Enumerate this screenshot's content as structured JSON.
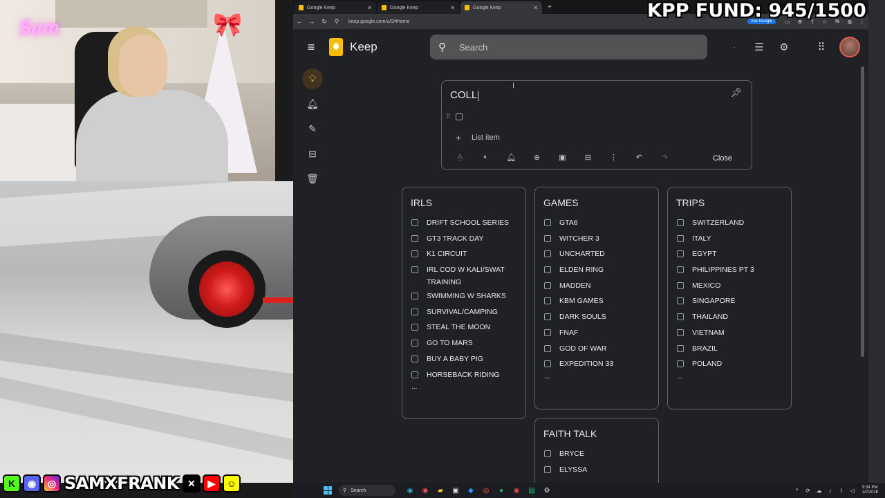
{
  "overlay": {
    "fund_text": "KPP FUND: 945/1500",
    "neon_sign": "Sam",
    "social_handle": "SAMXFRANK",
    "social_icons": [
      "kick-icon",
      "discord-icon",
      "instagram-icon",
      "x-icon",
      "youtube-icon",
      "snapchat-icon"
    ]
  },
  "browser": {
    "tabs": [
      {
        "label": "Google Keep",
        "active": false
      },
      {
        "label": "Google Keep",
        "active": false
      },
      {
        "label": "Google Keep",
        "active": true
      }
    ],
    "url": "keep.google.com/u/0/#home",
    "ask_google": "Ask Google"
  },
  "keep": {
    "app_title": "Keep",
    "search": {
      "placeholder": "Search",
      "value": ""
    },
    "sidebar": [
      "notes-bulb-icon",
      "reminders-bell-icon",
      "edit-labels-pencil-icon",
      "archive-icon",
      "trash-icon"
    ],
    "editor": {
      "title": "COLL",
      "add_item_label": "List item",
      "close_label": "Close"
    },
    "cards": [
      {
        "title": "IRLS",
        "items": [
          "DRIFT SCHOOL SERIES",
          "GT3 TRACK DAY",
          "K1 CIRCUIT",
          "IRL COD W KALI/SWAT TRAINING",
          "SWIMMING W SHARKS",
          "SURVIVAL/CAMPING",
          "STEAL THE MOON",
          "GO TO MARS",
          "BUY A BABY PIG",
          "HORSEBACK RIDING"
        ],
        "more": "..."
      },
      {
        "title": "GAMES",
        "items": [
          "GTA6",
          "WITCHER 3",
          "UNCHARTED",
          "ELDEN RING",
          "MADDEN",
          "KBM GAMES",
          "DARK SOULS",
          "FNAF",
          "GOD OF WAR",
          "EXPEDITION 33"
        ],
        "more": "..."
      },
      {
        "title": "TRIPS",
        "items": [
          "SWITZERLAND",
          "ITALY",
          "EGYPT",
          "PHILIPPINES PT 3",
          "MEXICO",
          "SINGAPORE",
          "THAILAND",
          "VIETNAM",
          "BRAZIL",
          "POLAND"
        ],
        "more": "..."
      },
      {
        "title": "FAITH TALK",
        "items": [
          "BRYCE",
          "ELYSSA"
        ],
        "more": ""
      }
    ]
  },
  "taskbar": {
    "search_label": "Search",
    "time": "9:34 PM",
    "date": "1/2/2026"
  },
  "colors": {
    "keep_yellow": "#fbbc04",
    "bg_dark": "#202124",
    "card_border": "#5f6368",
    "active_nav": "#41331c"
  }
}
